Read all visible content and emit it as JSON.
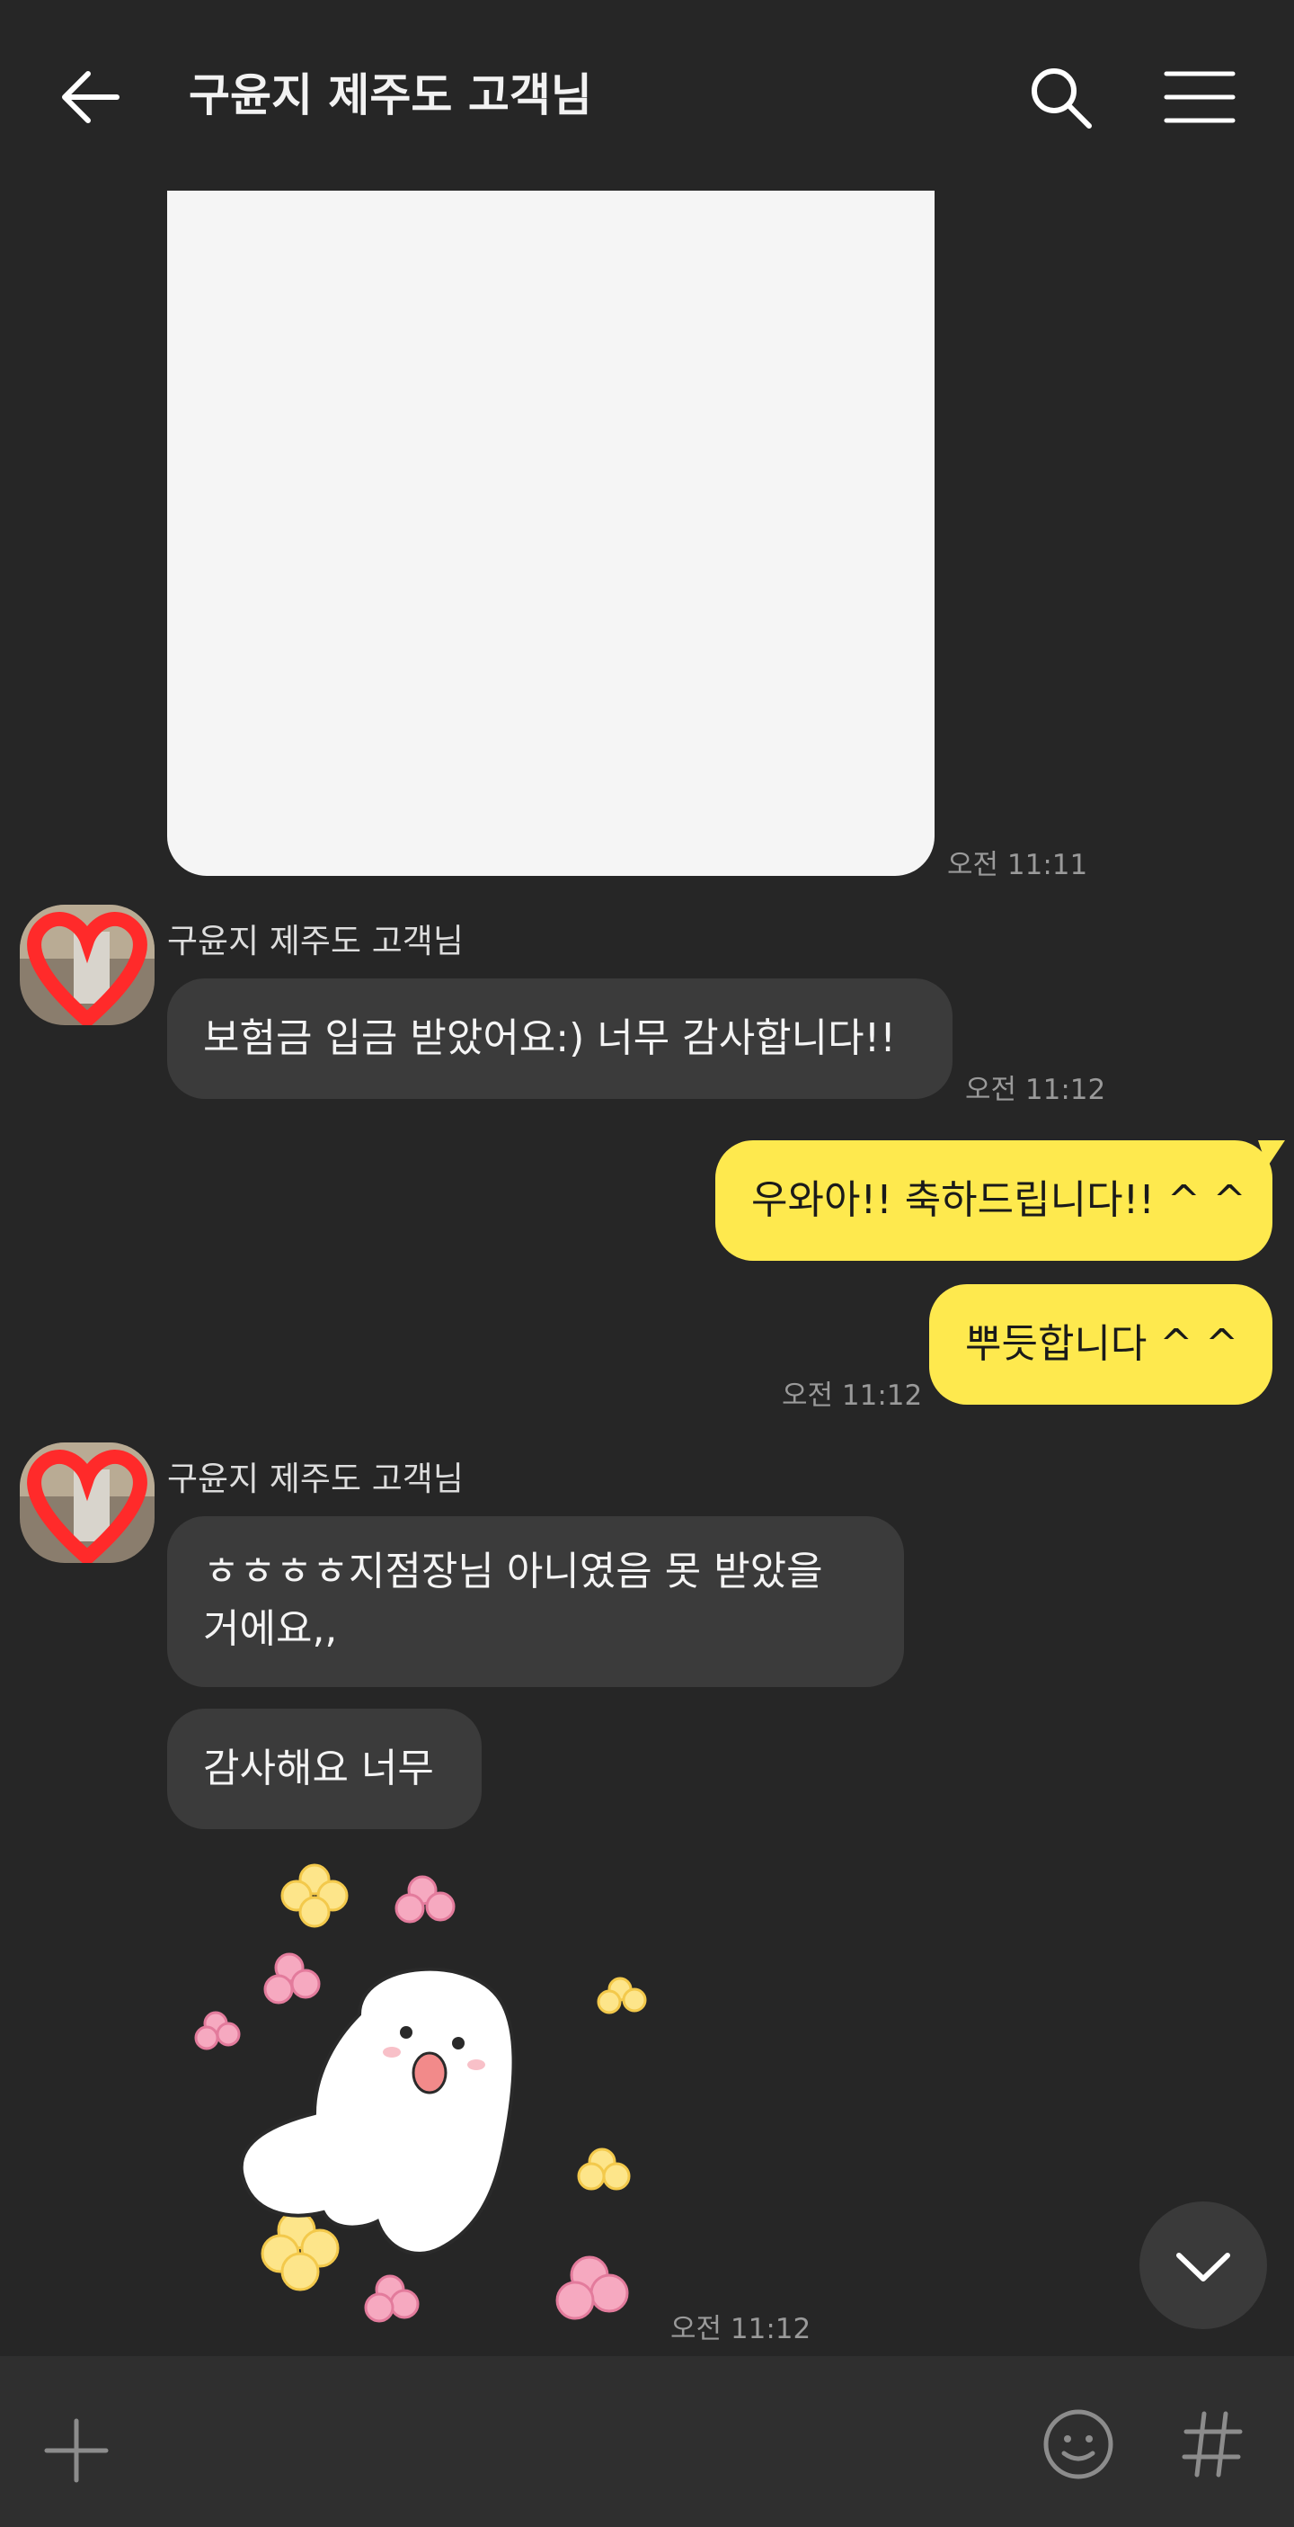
{
  "header": {
    "title": "구윤지 제주도 고객님",
    "back_icon": "back-arrow-icon",
    "search_icon": "search-icon",
    "menu_icon": "hamburger-menu-icon"
  },
  "messages": {
    "image_message": {
      "time": "오전 11:11"
    },
    "group1": {
      "sender": "구윤지 제주도 고객님",
      "text": "보험금 입금 받았어요:) 너무 감사합니다!!",
      "time": "오전 11:12"
    },
    "outgoing": {
      "msg1": "우와아!! 축하드립니다!! ^ ^",
      "msg2": "뿌듯합니다 ^ ^",
      "time": "오전 11:12"
    },
    "group2": {
      "sender": "구윤지 제주도 고객님",
      "text_line1": "ㅎㅎㅎㅎ지점장님 아니였음 못 받았을",
      "text_line2": "거에요,,",
      "text2": "감사해요 너무",
      "sticker_time": "오전 11:12"
    }
  },
  "colors": {
    "background": "#262626",
    "incoming_bubble": "#3b3b3b",
    "outgoing_bubble": "#fee94e",
    "input_bar": "#2f2f2f"
  },
  "input_bar": {
    "plus_icon": "plus-icon",
    "emoji_icon": "emoji-icon",
    "hash_icon": "hashtag-icon"
  },
  "scroll_button_icon": "chevron-down-icon"
}
